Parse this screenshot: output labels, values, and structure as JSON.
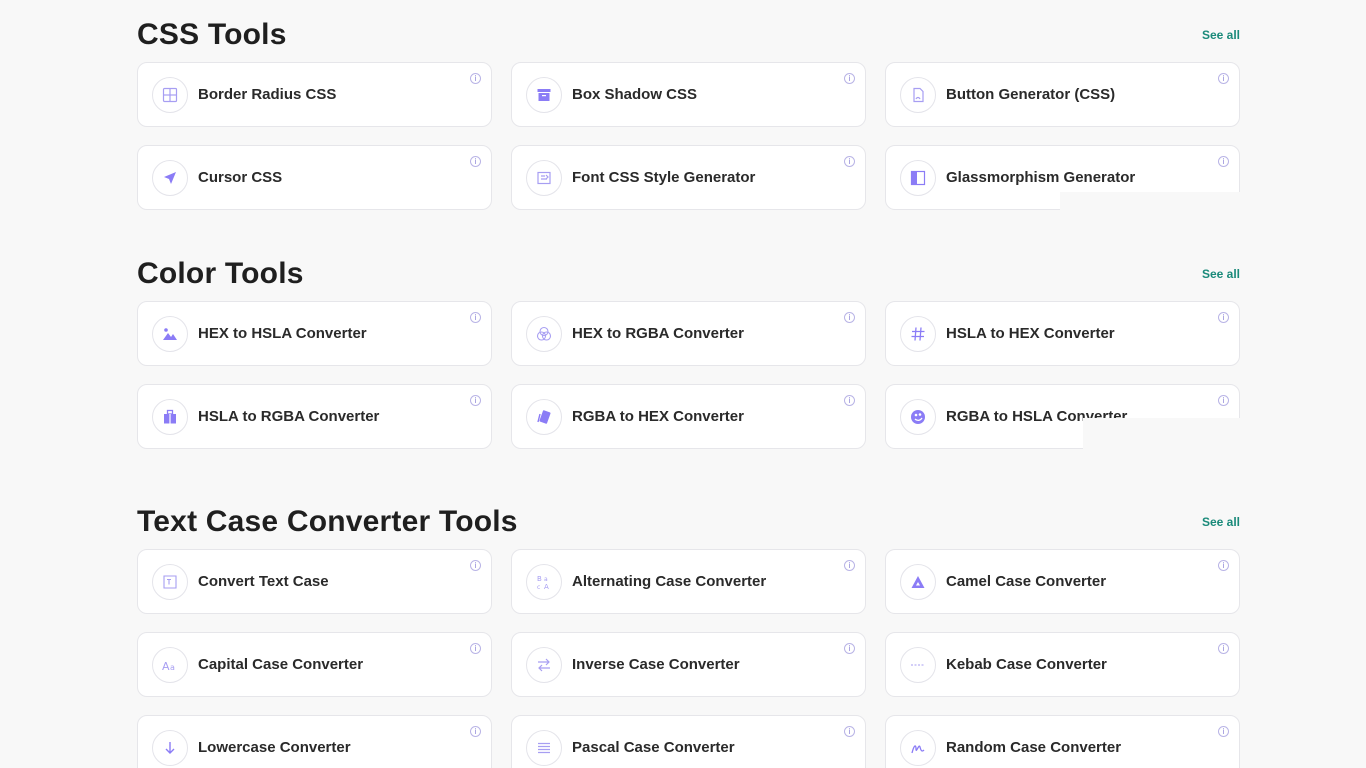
{
  "sections": [
    {
      "title": "CSS Tools",
      "see_all": "See all",
      "items": [
        {
          "label": "Border Radius CSS",
          "icon": "border-radius-icon"
        },
        {
          "label": "Box Shadow CSS",
          "icon": "box-shadow-icon"
        },
        {
          "label": "Button Generator (CSS)",
          "icon": "button-generator-icon"
        },
        {
          "label": "Cursor CSS",
          "icon": "cursor-icon"
        },
        {
          "label": "Font CSS Style Generator",
          "icon": "font-style-icon"
        },
        {
          "label": "Glassmorphism Generator",
          "icon": "glassmorphism-icon"
        }
      ]
    },
    {
      "title": "Color Tools",
      "see_all": "See all",
      "items": [
        {
          "label": "HEX to HSLA Converter",
          "icon": "mountain-icon"
        },
        {
          "label": "HEX to RGBA Converter",
          "icon": "color-circles-icon"
        },
        {
          "label": "HSLA to HEX Converter",
          "icon": "hash-icon"
        },
        {
          "label": "HSLA to RGBA Converter",
          "icon": "gift-icon"
        },
        {
          "label": "RGBA to HEX Converter",
          "icon": "swatch-icon"
        },
        {
          "label": "RGBA to HSLA Converter",
          "icon": "palette-icon"
        }
      ]
    },
    {
      "title": "Text Case Converter Tools",
      "see_all": "See all",
      "items": [
        {
          "label": "Convert Text Case",
          "icon": "text-frame-icon"
        },
        {
          "label": "Alternating Case Converter",
          "icon": "alternating-case-icon"
        },
        {
          "label": "Camel Case Converter",
          "icon": "camel-triangle-icon"
        },
        {
          "label": "Capital Case Converter",
          "icon": "capital-case-icon"
        },
        {
          "label": "Inverse Case Converter",
          "icon": "swap-arrows-icon"
        },
        {
          "label": "Kebab Case Converter",
          "icon": "kebab-dash-icon"
        },
        {
          "label": "Lowercase Converter",
          "icon": "arrow-down-icon"
        },
        {
          "label": "Pascal Case Converter",
          "icon": "lines-icon"
        },
        {
          "label": "Random Case Converter",
          "icon": "random-signature-icon"
        }
      ]
    }
  ],
  "info_glyph": "i",
  "colors": {
    "accent": "#8b7cf6",
    "see_all": "#1a8a7a",
    "background": "#f8f8f8"
  }
}
